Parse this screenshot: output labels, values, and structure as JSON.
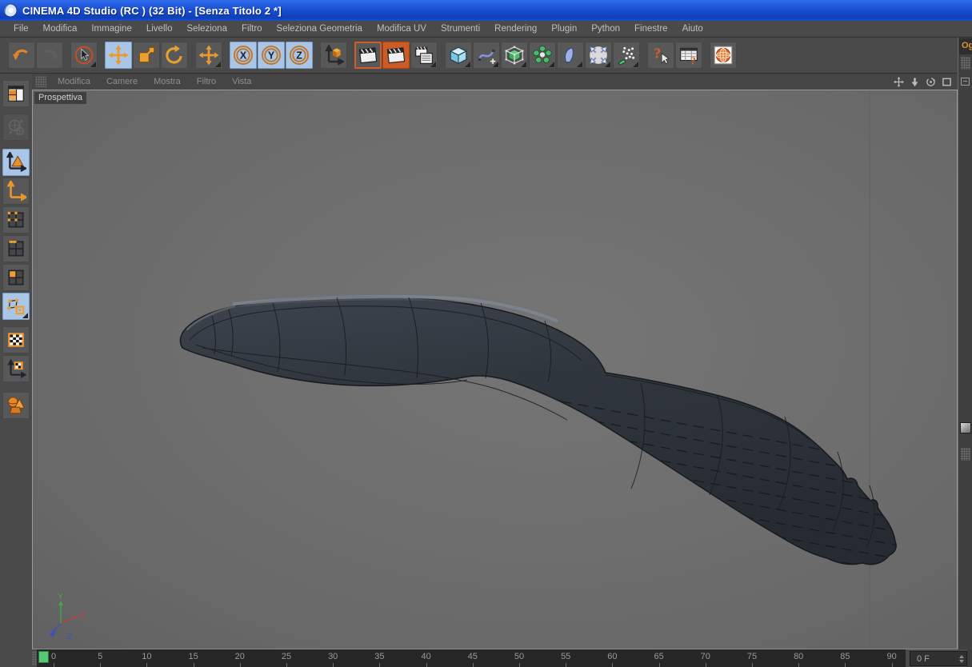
{
  "window": {
    "title": "CINEMA 4D Studio (RC ) (32 Bit) - [Senza Titolo 2 *]"
  },
  "menu_bar": {
    "items": [
      "File",
      "Modifica",
      "Immagine",
      "Livello",
      "Seleziona",
      "Filtro",
      "Seleziona Geometria",
      "Modifica UV",
      "Strumenti",
      "Rendering",
      "Plugin",
      "Python",
      "Finestre",
      "Aiuto"
    ]
  },
  "toolbar": {
    "groups": [
      {
        "buttons": [
          {
            "name": "undo",
            "icon": "undo-icon"
          },
          {
            "name": "redo",
            "icon": "redo-icon",
            "state": "disabled"
          }
        ]
      },
      {
        "buttons": [
          {
            "name": "live-selection",
            "icon": "live-selection-icon",
            "flyout": true
          }
        ]
      },
      {
        "buttons": [
          {
            "name": "move",
            "icon": "move-icon",
            "state": "selected"
          },
          {
            "name": "scale",
            "icon": "scale-icon"
          },
          {
            "name": "rotate",
            "icon": "rotate-icon"
          }
        ]
      },
      {
        "buttons": [
          {
            "name": "last-used-tool",
            "icon": "move-icon",
            "flyout": true
          }
        ]
      },
      {
        "buttons": [
          {
            "name": "lock-x-axis",
            "icon": "axis-x-icon",
            "state": "selected",
            "label": "X"
          },
          {
            "name": "lock-y-axis",
            "icon": "axis-y-icon",
            "state": "selected",
            "label": "Y"
          },
          {
            "name": "lock-z-axis",
            "icon": "axis-z-icon",
            "state": "selected",
            "label": "Z"
          }
        ]
      },
      {
        "buttons": [
          {
            "name": "coordinate-system",
            "icon": "coord-icon"
          }
        ]
      },
      {
        "buttons": [
          {
            "name": "render-view",
            "icon": "clapper-icon",
            "state": "outlined"
          },
          {
            "name": "render-picture-viewer",
            "icon": "clapper-icon",
            "state": "orange"
          },
          {
            "name": "render-settings",
            "icon": "clapper-settings-icon",
            "flyout": true
          }
        ]
      },
      {
        "buttons": [
          {
            "name": "add-primitive-cube",
            "icon": "cube-icon",
            "flyout": true
          },
          {
            "name": "spline-pen",
            "icon": "spline-icon",
            "flyout": true
          },
          {
            "name": "subdivision-surface",
            "icon": "subdiv-icon",
            "flyout": true
          },
          {
            "name": "generators",
            "icon": "generators-icon",
            "flyout": true
          },
          {
            "name": "deformers",
            "icon": "deformers-icon",
            "flyout": true
          },
          {
            "name": "environment-objects",
            "icon": "environment-icon",
            "flyout": true
          },
          {
            "name": "particles",
            "icon": "particles-icon",
            "flyout": true
          }
        ]
      },
      {
        "buttons": [
          {
            "name": "help",
            "icon": "help-icon"
          },
          {
            "name": "customize-commands",
            "icon": "command-help-icon"
          }
        ]
      },
      {
        "buttons": [
          {
            "name": "content-browser",
            "icon": "globe-icon"
          }
        ]
      }
    ]
  },
  "sidebar": {
    "items": [
      {
        "name": "uv-layout",
        "icon": "layout-grid-icon"
      },
      {
        "name": "projection-disabled",
        "icon": "globe-disabled-icon",
        "state": "disabled",
        "gap": 6
      },
      {
        "name": "model-mode",
        "icon": "model-mode-icon",
        "state": "selected",
        "gap": 8
      },
      {
        "name": "object-axis-mode",
        "icon": "axis-mode-icon"
      },
      {
        "name": "points-mode",
        "icon": "points-mode-icon"
      },
      {
        "name": "edges-mode",
        "icon": "edges-mode-icon"
      },
      {
        "name": "polygons-mode",
        "icon": "polygons-mode-icon"
      },
      {
        "name": "uv-edit-mode",
        "icon": "uv-mode-icon",
        "state": "selected",
        "flyout": true
      },
      {
        "name": "texture-mode",
        "icon": "texture-mode-icon",
        "gap": 6
      },
      {
        "name": "texture-axis-mode",
        "icon": "texture-axis-icon"
      },
      {
        "name": "workplane-objects",
        "icon": "objects-icon",
        "gap": 10
      }
    ]
  },
  "viewport": {
    "menu_items": [
      "Modifica",
      "Camere",
      "Mostra",
      "Filtro",
      "Vista"
    ],
    "controls": [
      {
        "name": "pan-view",
        "icon": "pan-icon"
      },
      {
        "name": "zoom-view",
        "icon": "zoom-icon"
      },
      {
        "name": "rotate-view",
        "icon": "orbit-icon"
      },
      {
        "name": "maximize-view",
        "icon": "maximize-icon"
      }
    ],
    "view_label": "Prospettiva",
    "axis_gizmo": {
      "x": "X",
      "y": "Y",
      "z": "Z"
    }
  },
  "right_panel": {
    "tab_label": "Og"
  },
  "timeline": {
    "ruler_values": [
      0,
      5,
      10,
      15,
      20,
      25,
      30,
      35,
      40,
      45,
      50,
      55,
      60,
      65,
      70,
      75,
      80,
      85,
      90
    ],
    "marker_value": 0,
    "frame_field_value": "0 F"
  },
  "colors": {
    "accent_orange": "#e8922e",
    "selection_blue": "#a9c6e6",
    "viewport_gray": "#6d6d6d",
    "object_fill": "#2d3239",
    "timeline_green": "#56c878",
    "titlebar_blue": "#1a4fd2",
    "axis_x_red": "#cc3a33",
    "axis_y_green": "#3fae3f",
    "axis_z_blue": "#3a4ecc"
  }
}
